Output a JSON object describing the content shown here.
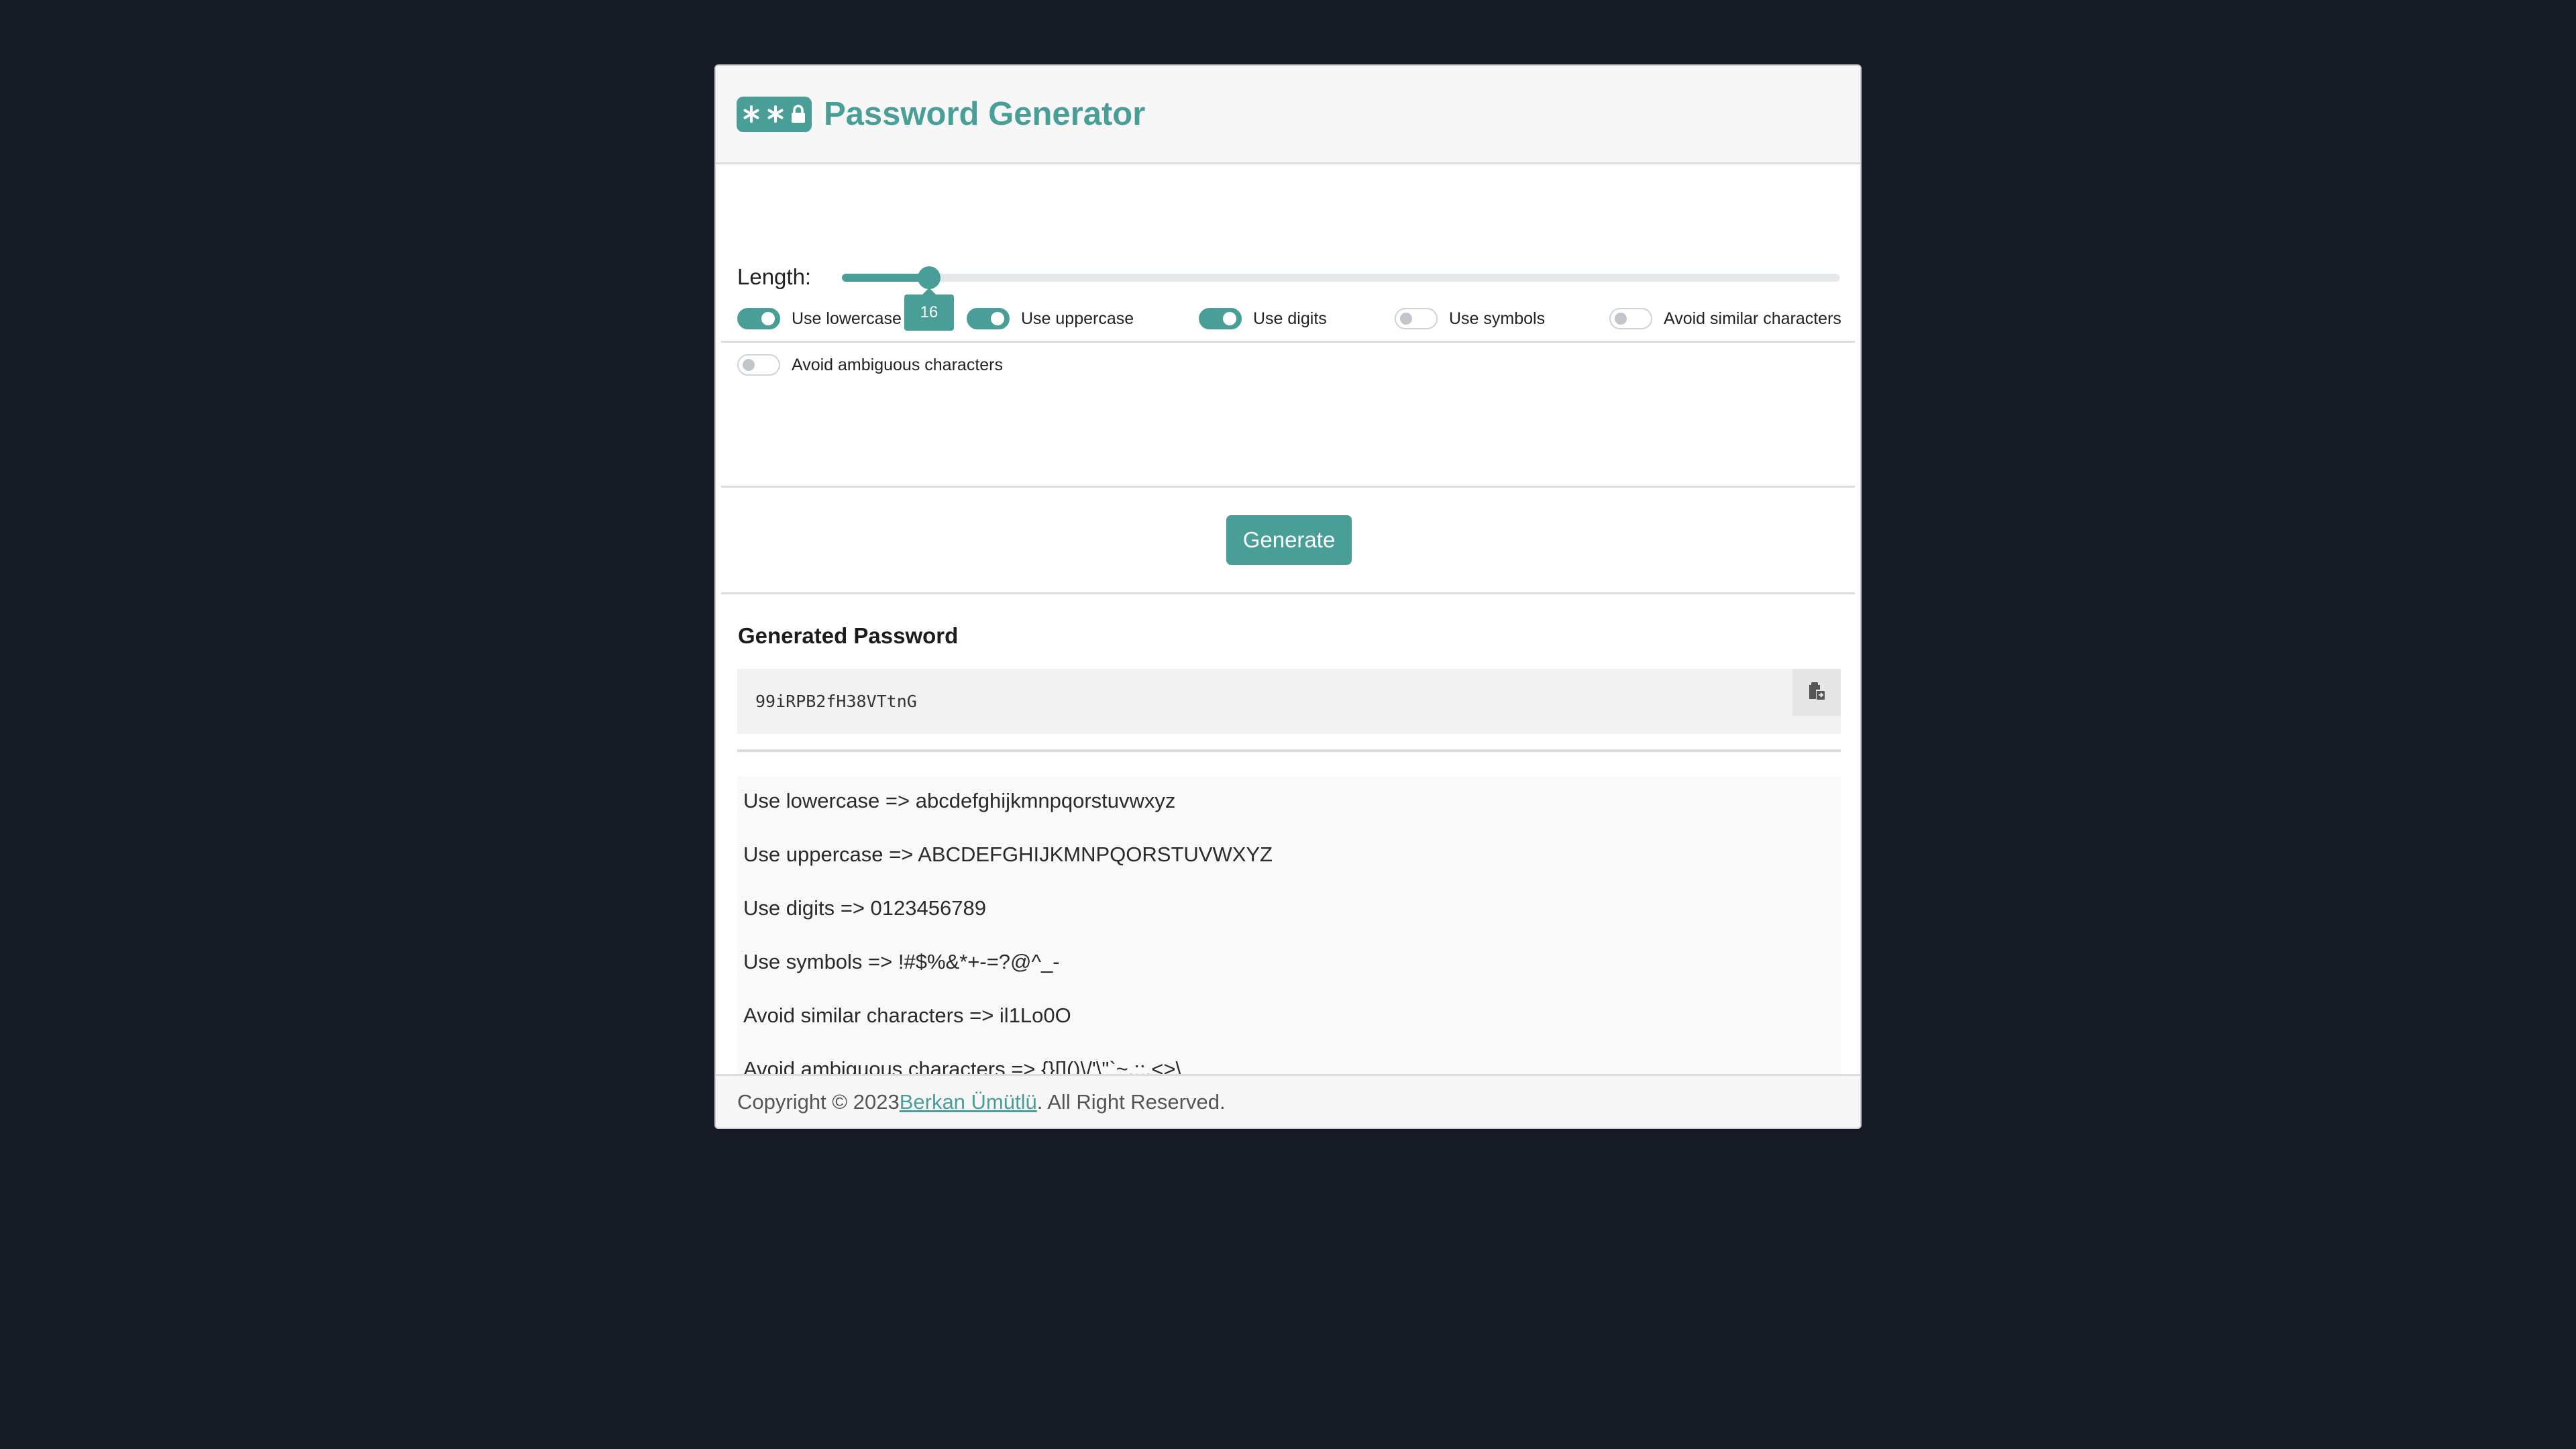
{
  "app": {
    "title": "Password Generator",
    "accent_color": "#4a9e98",
    "logo_icon": "password-lock-icon"
  },
  "length": {
    "label": "Length:",
    "value": "16",
    "min": 4,
    "max": 256
  },
  "options": [
    {
      "label": "Use lowercase",
      "enabled": true
    },
    {
      "label": "Use uppercase",
      "enabled": true
    },
    {
      "label": "Use digits",
      "enabled": true
    },
    {
      "label": "Use symbols",
      "enabled": false
    },
    {
      "label": "Avoid similar characters",
      "enabled": false
    },
    {
      "label": "Avoid ambiguous characters",
      "enabled": false
    }
  ],
  "generate_label": "Generate",
  "result": {
    "heading": "Generated Password",
    "password": "99iRPB2fH38VTtnG",
    "copy_icon": "clipboard-copy-icon"
  },
  "charsets": [
    "Use lowercase => abcdefghijkmnpqorstuvwxyz",
    "Use uppercase => ABCDEFGHIJKMNPQORSTUVWXYZ",
    "Use digits => 0123456789",
    "Use symbols => !#$%&*+-=?@^_-",
    "Avoid similar characters => il1Lo0O",
    "Avoid ambiguous characters => {}[]()\\/'\\\"`~,;:.<>\\"
  ],
  "footer": {
    "prefix": "Copyright © 2023 ",
    "author": "Berkan Ümütlü",
    "suffix": ". All Right Reserved."
  }
}
